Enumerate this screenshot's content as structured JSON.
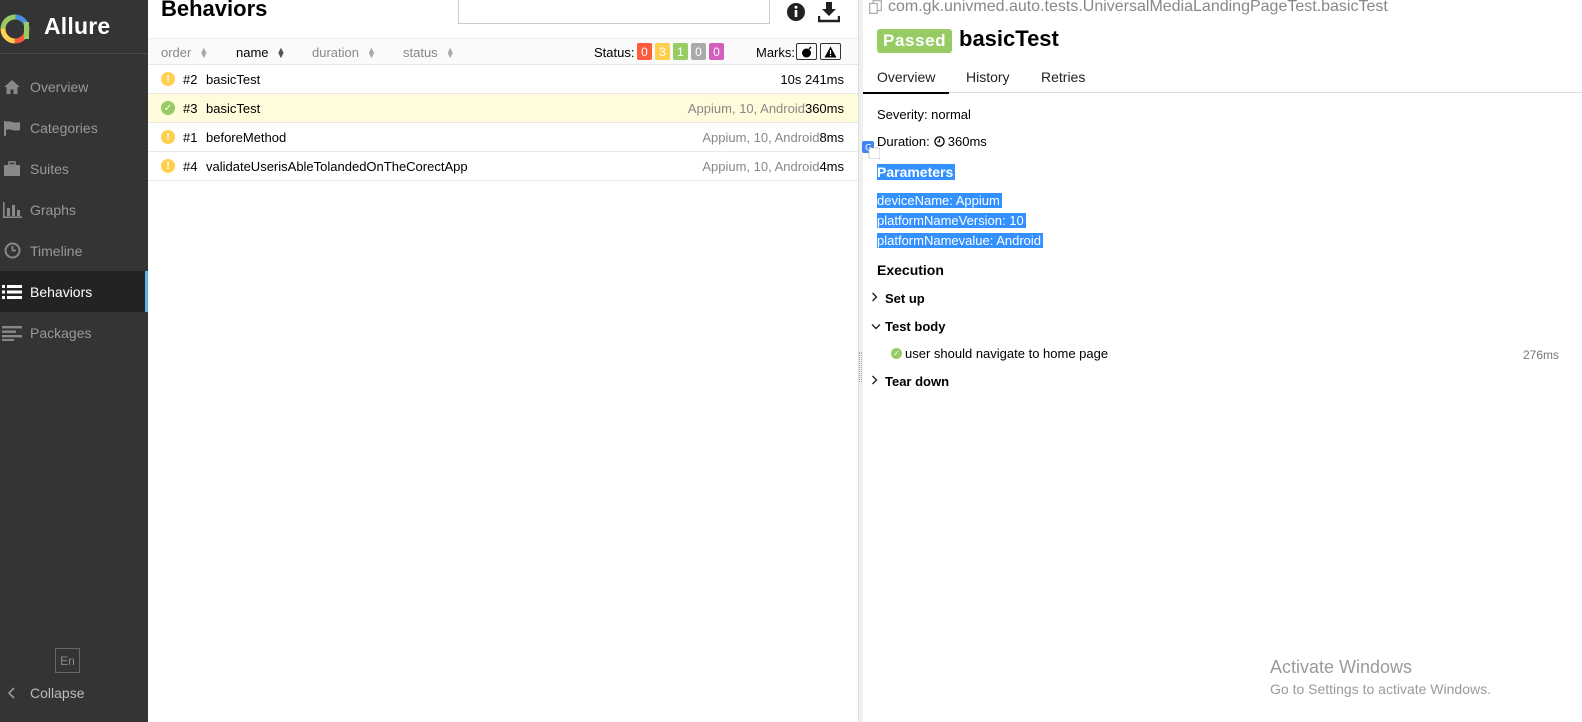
{
  "sidebar": {
    "brand": "Allure",
    "items": [
      {
        "label": "Overview",
        "icon": "home-icon"
      },
      {
        "label": "Categories",
        "icon": "flag-icon"
      },
      {
        "label": "Suites",
        "icon": "briefcase-icon"
      },
      {
        "label": "Graphs",
        "icon": "bar-chart-icon"
      },
      {
        "label": "Timeline",
        "icon": "clock-icon"
      },
      {
        "label": "Behaviors",
        "icon": "list-icon"
      },
      {
        "label": "Packages",
        "icon": "align-left-icon"
      }
    ],
    "active": "Behaviors",
    "lang": "En",
    "collapse": "Collapse"
  },
  "behaviors": {
    "title": "Behaviors",
    "sort": {
      "order": "order",
      "name": "name",
      "duration": "duration",
      "status": "status"
    },
    "status_label": "Status:",
    "status_counts": [
      {
        "value": "0",
        "color": "#fd5a3e"
      },
      {
        "value": "3",
        "color": "#ffd050"
      },
      {
        "value": "1",
        "color": "#97cc64"
      },
      {
        "value": "0",
        "color": "#aaaaaa"
      },
      {
        "value": "0",
        "color": "#d35ebe"
      }
    ],
    "marks_label": "Marks:",
    "rows": [
      {
        "status": "broken",
        "num": "#2",
        "name": "basicTest",
        "params": "",
        "dur": "10s 241ms"
      },
      {
        "status": "passed",
        "num": "#3",
        "name": "basicTest",
        "params": "Appium, 10, Android",
        "dur": "360ms"
      },
      {
        "status": "broken",
        "num": "#1",
        "name": "beforeMethod",
        "params": "Appium, 10, Android",
        "dur": "8ms"
      },
      {
        "status": "broken",
        "num": "#4",
        "name": "validateUserisAbleTolandedOnTheCorectApp",
        "params": "Appium, 10, Android",
        "dur": "4ms"
      }
    ]
  },
  "detail": {
    "fullname": "com.gk.univmed.auto.tests.UniversalMediaLandingPageTest.basicTest",
    "status": "Passed",
    "title": "basicTest",
    "tabs": [
      "Overview",
      "History",
      "Retries"
    ],
    "severity": "Severity: normal",
    "duration_label": "Duration:",
    "duration": "360ms",
    "parameters_title": "Parameters",
    "parameters": [
      "deviceName: Appium",
      "platformNameVersion: 10",
      "platformNamevalue: Android"
    ],
    "execution_title": "Execution",
    "setup": "Set up",
    "body": "Test body",
    "step": "user should navigate to home page",
    "step_dur": "276ms",
    "teardown": "Tear down"
  },
  "watermark": {
    "line1": "Activate Windows",
    "line2": "Go to Settings to activate Windows."
  },
  "colors": {
    "passed": "#97cc64",
    "broken": "#ffd050",
    "selection": "#3390ff"
  }
}
